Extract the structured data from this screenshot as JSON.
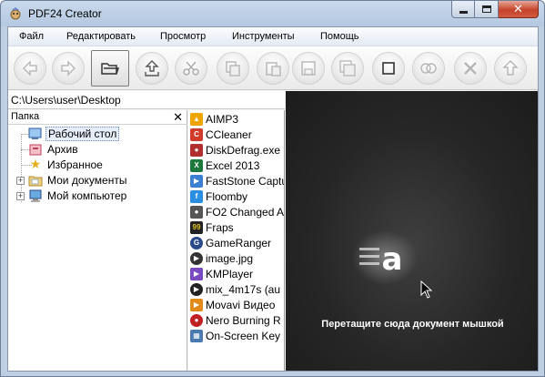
{
  "window": {
    "title": "PDF24 Creator",
    "controls": {
      "minimize": "minimize-icon",
      "maximize": "maximize-icon",
      "close": "close-icon"
    }
  },
  "menu": [
    "Файл",
    "Редактировать",
    "Просмотр",
    "Инструменты",
    "Помощь"
  ],
  "toolbar": {
    "buttons": [
      {
        "icon": "back-arrow-icon",
        "active": false
      },
      {
        "icon": "forward-arrow-icon",
        "active": false
      },
      {
        "icon": "open-folder-icon",
        "active": true
      },
      {
        "icon": "import-icon",
        "active": false
      },
      {
        "icon": "cut-icon",
        "active": false
      },
      {
        "icon": "copy-icon",
        "active": false
      },
      {
        "icon": "paste-icon",
        "active": false
      },
      {
        "icon": "save-icon",
        "active": false
      },
      {
        "icon": "save-all-icon",
        "active": false
      },
      {
        "icon": "select-icon",
        "active": false
      },
      {
        "icon": "merge-icon",
        "active": false
      },
      {
        "icon": "delete-icon",
        "active": false
      },
      {
        "icon": "up-arrow-icon",
        "active": false
      }
    ]
  },
  "path": "C:\\Users\\user\\Desktop",
  "tree": {
    "title": "Папка",
    "close": "✕",
    "items": [
      {
        "label": "Рабочий стол",
        "icon": "desktop-icon",
        "selected": true,
        "expander": false
      },
      {
        "label": "Архив",
        "icon": "archive-icon",
        "selected": false,
        "expander": false
      },
      {
        "label": "Избранное",
        "icon": "star-icon",
        "selected": false,
        "expander": false
      },
      {
        "label": "Мои документы",
        "icon": "documents-folder-icon",
        "selected": false,
        "expander": true
      },
      {
        "label": "Мой компьютер",
        "icon": "computer-icon",
        "selected": false,
        "expander": true
      }
    ]
  },
  "files": [
    {
      "label": "AIMP3",
      "icon": "aimp-icon",
      "color": "#f0a400"
    },
    {
      "label": "CCleaner",
      "icon": "ccleaner-icon",
      "color": "#d23a2a"
    },
    {
      "label": "DiskDefrag.exe",
      "icon": "diskdefrag-icon",
      "color": "#b03030"
    },
    {
      "label": "Excel 2013",
      "icon": "excel-icon",
      "color": "#1e7a3c"
    },
    {
      "label": "FastStone Capture",
      "icon": "faststone-icon",
      "color": "#3a7fd0"
    },
    {
      "label": "Floomby",
      "icon": "floomby-icon",
      "color": "#2a8fe0"
    },
    {
      "label": "FO2 Changed A",
      "icon": "fo2-icon",
      "color": "#555555"
    },
    {
      "label": "Fraps",
      "icon": "fraps-icon",
      "color": "#e0c020"
    },
    {
      "label": "GameRanger",
      "icon": "gameranger-icon",
      "color": "#2b4a8a"
    },
    {
      "label": "image.jpg",
      "icon": "image-file-icon",
      "color": "#333333"
    },
    {
      "label": "KMPlayer",
      "icon": "kmplayer-icon",
      "color": "#7a4ac0"
    },
    {
      "label": "mix_4m17s (au",
      "icon": "audio-file-icon",
      "color": "#222222"
    },
    {
      "label": "Movavi Видео",
      "icon": "movavi-icon",
      "color": "#e08a1a"
    },
    {
      "label": "Nero Burning R",
      "icon": "nero-icon",
      "color": "#c02020"
    },
    {
      "label": "On-Screen Key",
      "icon": "keyboard-icon",
      "color": "#4a7ab0"
    }
  ],
  "dropzone": {
    "text": "Перетащите сюда документ мышкой",
    "logo": "pdf24-logo-icon",
    "cursor": "mouse-cursor-icon"
  }
}
